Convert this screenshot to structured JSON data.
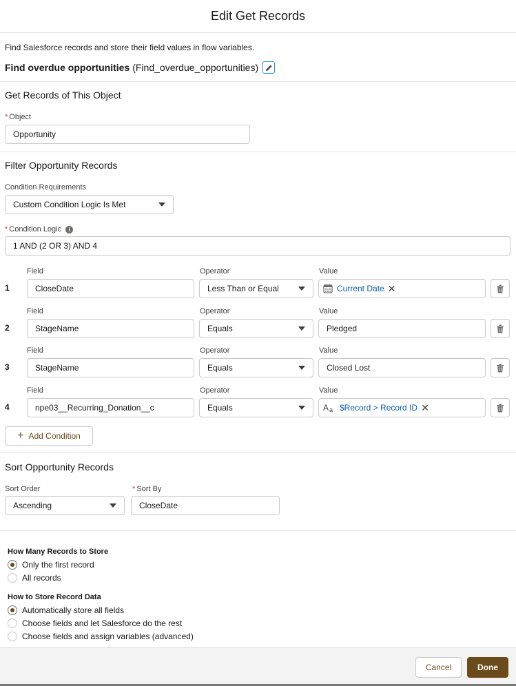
{
  "modal": {
    "title": "Edit Get Records"
  },
  "intro": {
    "description": "Find Salesforce records and store their field values in flow variables.",
    "label": "Find overdue opportunities",
    "api_name": "(Find_overdue_opportunities)"
  },
  "object_section": {
    "title": "Get Records of This Object",
    "object_label": "Object",
    "object_value": "Opportunity"
  },
  "filter_section": {
    "title": "Filter Opportunity Records",
    "requirements_label": "Condition Requirements",
    "requirements_value": "Custom Condition Logic Is Met",
    "logic_label": "Condition Logic",
    "logic_value": "1 AND (2 OR 3) AND 4",
    "headers": {
      "field": "Field",
      "operator": "Operator",
      "value": "Value"
    },
    "conditions": [
      {
        "num": "1",
        "field": "CloseDate",
        "operator": "Less Than or Equal",
        "value": "Current Date",
        "value_type": "pill",
        "value_icon": "calendar-icon"
      },
      {
        "num": "2",
        "field": "StageName",
        "operator": "Equals",
        "value": "Pledged",
        "value_type": "text"
      },
      {
        "num": "3",
        "field": "StageName",
        "operator": "Equals",
        "value": "Closed Lost",
        "value_type": "text"
      },
      {
        "num": "4",
        "field": "npe03__Recurring_Donation__c",
        "operator": "Equals",
        "value": "$Record > Record ID",
        "value_type": "pill",
        "value_icon": "text-type-icon"
      }
    ],
    "add_condition_label": "Add Condition"
  },
  "sort_section": {
    "title": "Sort Opportunity Records",
    "order_label": "Sort Order",
    "order_value": "Ascending",
    "by_label": "Sort By",
    "by_value": "CloseDate"
  },
  "store_section": {
    "how_many_title": "How Many Records to Store",
    "how_many_options": [
      "Only the first record",
      "All records"
    ],
    "how_many_selected": 0,
    "how_store_title": "How to Store Record Data",
    "how_store_options": [
      "Automatically store all fields",
      "Choose fields and let Salesforce do the rest",
      "Choose fields and assign variables (advanced)"
    ],
    "how_store_selected": 0
  },
  "footer": {
    "cancel_label": "Cancel",
    "done_label": "Done"
  },
  "colors": {
    "brand": "#6b4a1b",
    "link": "#0b5cab",
    "required": "#c23934"
  }
}
